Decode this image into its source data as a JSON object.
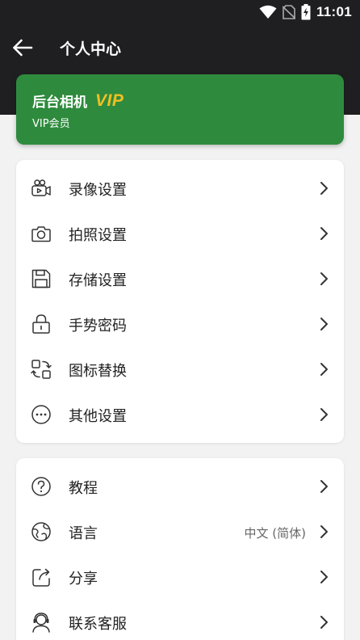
{
  "status_bar": {
    "time": "11:01",
    "icons": [
      "wifi-icon",
      "no-sim-icon",
      "battery-charging-icon"
    ]
  },
  "header": {
    "title": "个人中心",
    "back_icon": "arrow-left-icon"
  },
  "vip_card": {
    "name": "后台相机",
    "badge": "VIP",
    "subtitle": "VIP会员",
    "background_color": "#2e8b3d",
    "badge_color": "#f2bf22"
  },
  "settings_group": [
    {
      "label": "录像设置",
      "icon": "video-camera-icon"
    },
    {
      "label": "拍照设置",
      "icon": "camera-icon"
    },
    {
      "label": "存储设置",
      "icon": "save-disk-icon"
    },
    {
      "label": "手势密码",
      "icon": "lock-icon"
    },
    {
      "label": "图标替换",
      "icon": "icon-swap-icon"
    },
    {
      "label": "其他设置",
      "icon": "more-circle-icon"
    }
  ],
  "misc_group": [
    {
      "label": "教程",
      "icon": "help-circle-icon"
    },
    {
      "label": "语言",
      "icon": "globe-icon",
      "value": "中文 (简体)"
    },
    {
      "label": "分享",
      "icon": "share-icon"
    },
    {
      "label": "联系客服",
      "icon": "customer-service-icon"
    }
  ]
}
